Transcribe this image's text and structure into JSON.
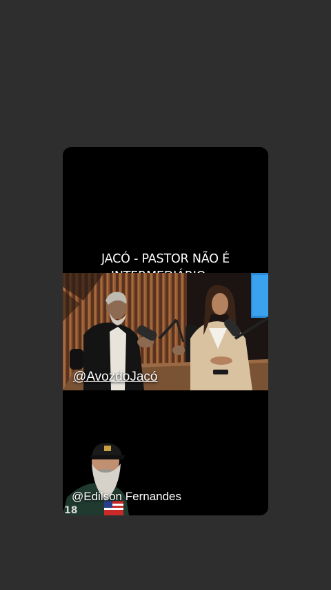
{
  "background_color": "#2e2e2e",
  "video": {
    "caption_line_1": "JACÓ - PASTOR NÃO É",
    "caption_line_2": "INTERMEDIÁRIO....",
    "channel_handle": "@AvozdoJacó",
    "presenter_name": "@Edilson Fernandes"
  }
}
